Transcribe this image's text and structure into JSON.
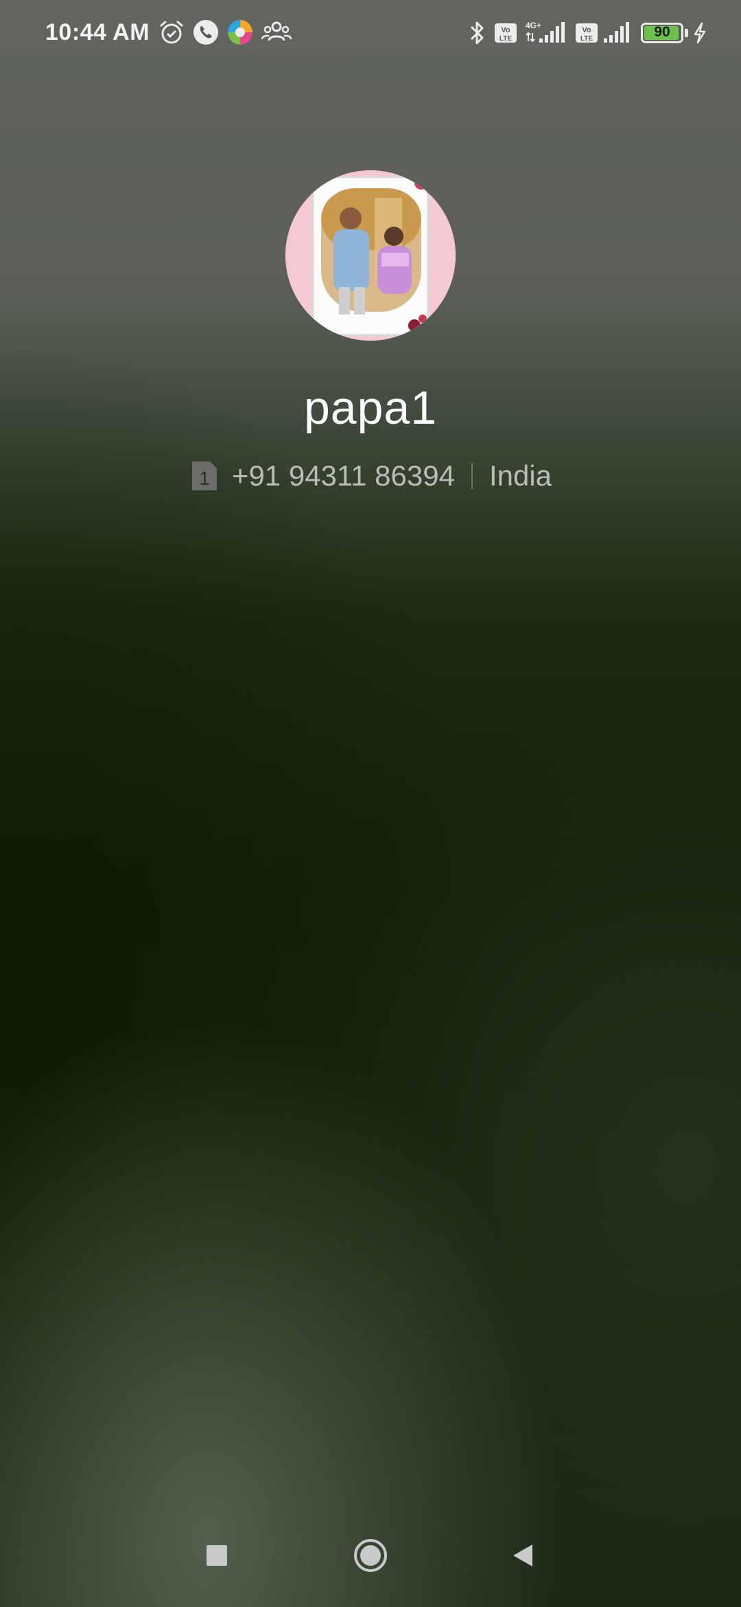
{
  "status_bar": {
    "time": "10:44 AM",
    "left_icons": [
      "alarm-icon",
      "phone-call-icon",
      "colorful-app-icon",
      "group-icon"
    ],
    "right_icons": [
      "bluetooth-icon",
      "volte-icon",
      "signal-4g-icon",
      "volte-icon",
      "signal-icon"
    ],
    "network_label_1": "4G+",
    "volte_label": "Vo LTE",
    "battery_level": "90",
    "battery_color": "#6cc24a",
    "charging": "charging-bolt-icon"
  },
  "caller": {
    "name": "papa1",
    "sim_slot": "1",
    "number": "+91 94311 86394",
    "location": "India"
  },
  "nav": {
    "recents": "square-icon",
    "home": "circle-icon",
    "back": "triangle-back-icon"
  }
}
